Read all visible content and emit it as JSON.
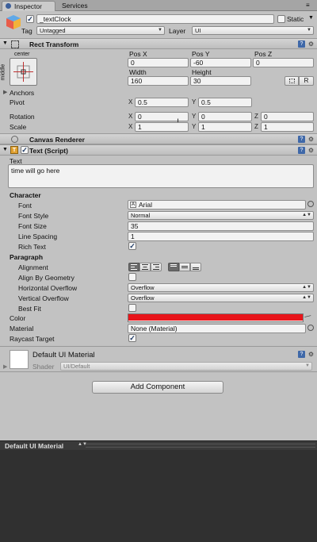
{
  "tabs": [
    {
      "label": "Inspector"
    },
    {
      "label": "Services"
    }
  ],
  "object": {
    "name": "_textClock",
    "static_label": "Static",
    "tag_label": "Tag",
    "tag_value": "Untagged",
    "layer_label": "Layer",
    "layer_value": "UI"
  },
  "rect_transform": {
    "title": "Rect Transform",
    "anchor_top": "center",
    "anchor_side": "middle",
    "posx_label": "Pos X",
    "posy_label": "Pos Y",
    "posz_label": "Pos Z",
    "posx": "0",
    "posy": "-60",
    "posz": "0",
    "width_label": "Width",
    "height_label": "Height",
    "width": "160",
    "height": "30",
    "r_button": "R",
    "anchors_label": "Anchors",
    "pivot_label": "Pivot",
    "pivot_x": "0.5",
    "pivot_y": "0.5",
    "rotation_label": "Rotation",
    "rot_x": "0",
    "rot_y": "0",
    "rot_z": "0",
    "scale_label": "Scale",
    "scale_x": "1",
    "scale_y": "1",
    "scale_z": "1",
    "x": "X",
    "y": "Y",
    "z": "Z"
  },
  "canvas_renderer": {
    "title": "Canvas Renderer"
  },
  "text_script": {
    "title": "Text (Script)",
    "text_label": "Text",
    "text_value": "time will go here",
    "character_label": "Character",
    "font_label": "Font",
    "font_value": "Arial",
    "font_style_label": "Font Style",
    "font_style_value": "Normal",
    "font_size_label": "Font Size",
    "font_size_value": "35",
    "line_spacing_label": "Line Spacing",
    "line_spacing_value": "1",
    "rich_text_label": "Rich Text",
    "paragraph_label": "Paragraph",
    "alignment_label": "Alignment",
    "align_geometry_label": "Align By Geometry",
    "h_overflow_label": "Horizontal Overflow",
    "h_overflow_value": "Overflow",
    "v_overflow_label": "Vertical Overflow",
    "v_overflow_value": "Overflow",
    "best_fit_label": "Best Fit",
    "color_label": "Color",
    "color_value": "#e8141a",
    "material_label": "Material",
    "material_value": "None (Material)",
    "raycast_label": "Raycast Target"
  },
  "material": {
    "name": "Default UI Material",
    "shader_label": "Shader",
    "shader_value": "UI/Default"
  },
  "add_component_label": "Add Component",
  "preview": {
    "title": "Default UI Material"
  }
}
